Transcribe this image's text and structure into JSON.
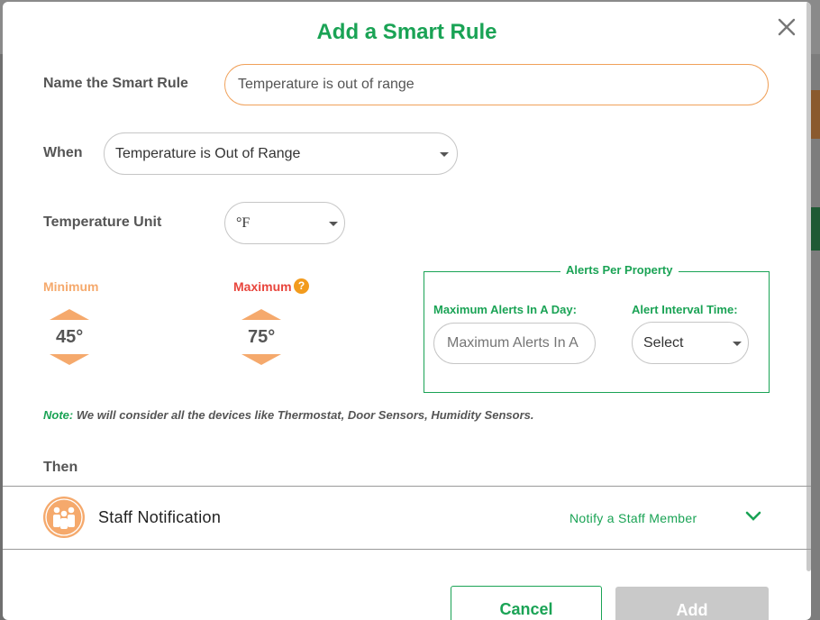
{
  "modal": {
    "title": "Add a Smart Rule"
  },
  "name_rule": {
    "label": "Name the Smart Rule",
    "value": "Temperature is out of range"
  },
  "when": {
    "label": "When",
    "selected": "Temperature is Out of Range"
  },
  "temp_unit": {
    "label": "Temperature Unit",
    "selected": "°F"
  },
  "minimum": {
    "label": "Minimum",
    "value": "45°",
    "color": "#f5a96c"
  },
  "maximum": {
    "label": "Maximum",
    "value": "75°",
    "color": "#e8453c",
    "help_icon": "?"
  },
  "alerts": {
    "legend": "Alerts Per Property",
    "max_label": "Maximum Alerts In A Day:",
    "max_placeholder": "Maximum Alerts In A Day",
    "interval_label": "Alert Interval Time:",
    "interval_selected": "Select"
  },
  "note": {
    "prefix": "Note:",
    "text": " We will consider all the devices like Thermostat, Door Sensors, Humidity Sensors."
  },
  "then": {
    "label": "Then"
  },
  "staff": {
    "label": "Staff Notification",
    "link": "Notify a Staff Member",
    "icon": "staff-group-icon"
  },
  "buttons": {
    "cancel": "Cancel",
    "add": "Add"
  },
  "colors": {
    "accent_green": "#1aa355",
    "accent_orange": "#f5a96c"
  }
}
